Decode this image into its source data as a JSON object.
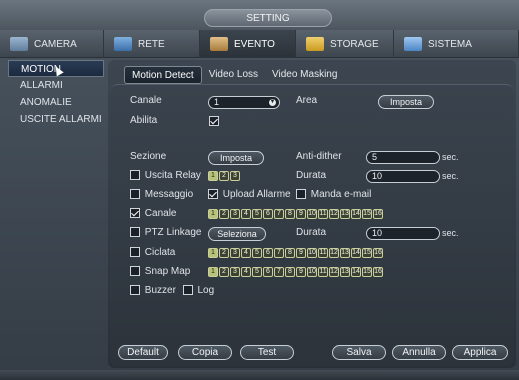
{
  "window": {
    "title": "SETTING"
  },
  "topnav": [
    {
      "label": "CAMERA",
      "icon": "camera-icon"
    },
    {
      "label": "RETE",
      "icon": "network-icon"
    },
    {
      "label": "EVENTO",
      "icon": "event-icon"
    },
    {
      "label": "STORAGE",
      "icon": "storage-icon"
    },
    {
      "label": "SISTEMA",
      "icon": "system-icon"
    }
  ],
  "sidebar": {
    "items": [
      "MOTION",
      "ALLARMI",
      "ANOMALIE",
      "USCITE ALLARMI"
    ]
  },
  "subtabs": [
    "Motion Detect",
    "Video Loss",
    "Video Masking"
  ],
  "form": {
    "canale_label": "Canale",
    "canale_value": "1",
    "area_label": "Area",
    "area_button": "Imposta",
    "abilita_label": "Abilita",
    "sezione_label": "Sezione",
    "sezione_button": "Imposta",
    "antidither_label": "Anti-dither",
    "antidither_value": "5",
    "antidither_unit": "sec.",
    "uscita_relay_label": "Uscita Relay",
    "relay_numbers": [
      "1",
      "2",
      "3"
    ],
    "durata_label": "Durata",
    "durata_value": "10",
    "durata_unit": "sec.",
    "messaggio_label": "Messaggio",
    "upload_allarme_label": "Upload Allarme",
    "manda_email_label": "Manda e-mail",
    "canale2_label": "Canale",
    "channel_numbers": [
      "1",
      "2",
      "3",
      "4",
      "5",
      "6",
      "7",
      "8",
      "9",
      "10",
      "11",
      "12",
      "13",
      "14",
      "15",
      "16"
    ],
    "ptz_linkage_label": "PTZ Linkage",
    "seleziona_button": "Seleziona",
    "durata2_label": "Durata",
    "durata2_value": "10",
    "durata2_unit": "sec.",
    "ciclata_label": "Ciclata",
    "snap_map_label": "Snap Map",
    "buzzer_label": "Buzzer",
    "log_label": "Log"
  },
  "buttons": {
    "default": "Default",
    "copia": "Copia",
    "test": "Test",
    "salva": "Salva",
    "annulla": "Annulla",
    "applica": "Applica"
  }
}
